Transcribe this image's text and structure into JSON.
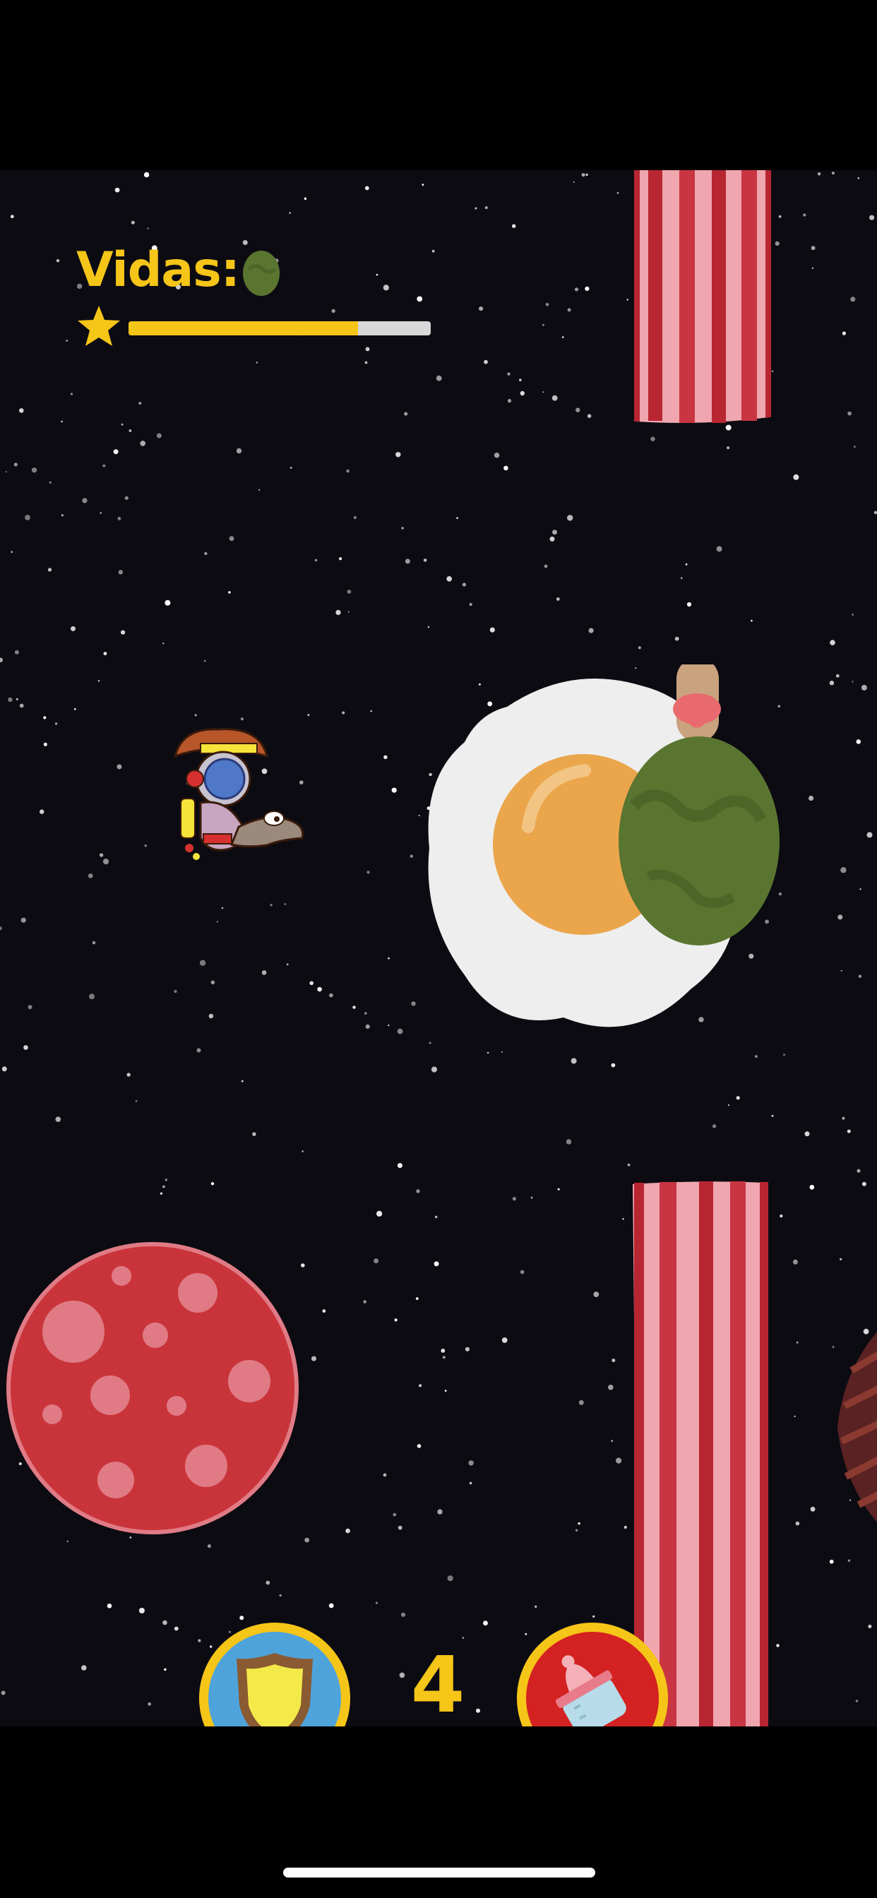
{
  "hud": {
    "lives_label": "Vidas:",
    "lives_icon": "green-egg-icon",
    "progress_icon": "star-icon",
    "progress_fraction": 0.76
  },
  "scene": {
    "background_color": "#0c0b12",
    "objects": [
      "bacon-strip",
      "fried-egg-planet",
      "pickle-egg-with-pacifier",
      "salami-planet",
      "astronaut-cowboy-player",
      "meat-planet-edge"
    ]
  },
  "controls": {
    "shield_icon": "shield-icon",
    "bottle_icon": "baby-bottle-icon",
    "power_count": "4"
  },
  "colors": {
    "accent_yellow": "#f5c518",
    "shield_button_bg": "#4fa3db",
    "bottle_button_bg": "#d42121",
    "progress_track": "#d8d8d8"
  }
}
